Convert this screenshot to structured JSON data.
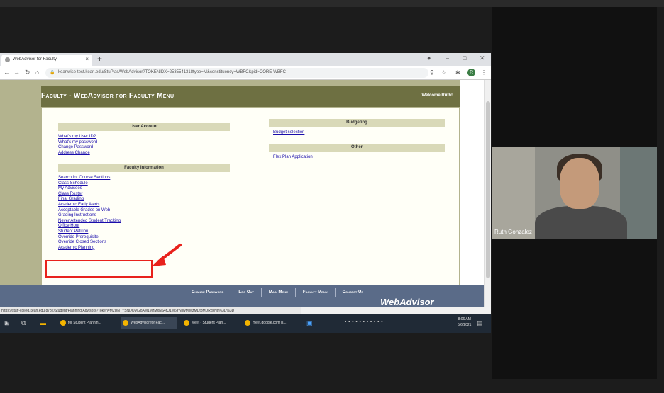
{
  "browser": {
    "tab_title": "WebAdvisor for Faculty",
    "tab_close": "×",
    "new_tab": "+",
    "url": "keanwise-test.kean.edu/StuPlas/WebAdvisor?TOKENIDX=2535541318type=M&constituency=WBFC&pid=CORE-WBFC",
    "status_url": "https://staff-colleg.kean.edu:8732/Student/Planning/Advisors?Token=M2UNTYSNDQMGoAM1MzMxNS4tQ1M6YNjjwMjMzMDtbMDRgxNg%3D%3D",
    "profile_initial": "R"
  },
  "page": {
    "title": "Faculty - WebAdvisor for Faculty Menu",
    "welcome": "Welcome Ruth!",
    "sections": {
      "user_account": {
        "header": "User Account",
        "links": [
          "What's my User ID?",
          "What's my password",
          "Change Password",
          "Address Change"
        ]
      },
      "faculty_information": {
        "header": "Faculty Information",
        "links": [
          "Search for Course Sections",
          "Class Schedule",
          "My Advisees",
          "Class Roster",
          "Final Grading",
          "Academic Early Alerts",
          "Acceptable Grades on Web",
          "Grading Instructions",
          "Never Attended Student Tracking",
          "Office Hour",
          "Student Petition",
          "Override Prerequisite",
          "Override Closed Sections",
          "Academic Planning"
        ]
      },
      "budgeting": {
        "header": "Budgeting",
        "links": [
          "Budget selection"
        ]
      },
      "other": {
        "header": "Other",
        "links": [
          "Flex Plan Application"
        ]
      }
    },
    "bottom_nav": [
      "Change Password",
      "Log Out",
      "Main Menu",
      "Faculty Menu",
      "Contact Us"
    ],
    "logo": "WebAdvisor"
  },
  "taskbar": {
    "items": [
      "for Student Plannin...",
      "WebAdvisor for Fac...",
      "Meet - Student Plan...",
      "meet.google.com is..."
    ],
    "time": "8:06 AM",
    "date": "5/6/2021"
  },
  "participant": {
    "name": "Ruth Gonzalez"
  },
  "colors": {
    "olive": "#6e7042",
    "navy_band": "#5a6b88",
    "annotation_red": "#e8221c",
    "link_blue": "#1a0dab"
  }
}
